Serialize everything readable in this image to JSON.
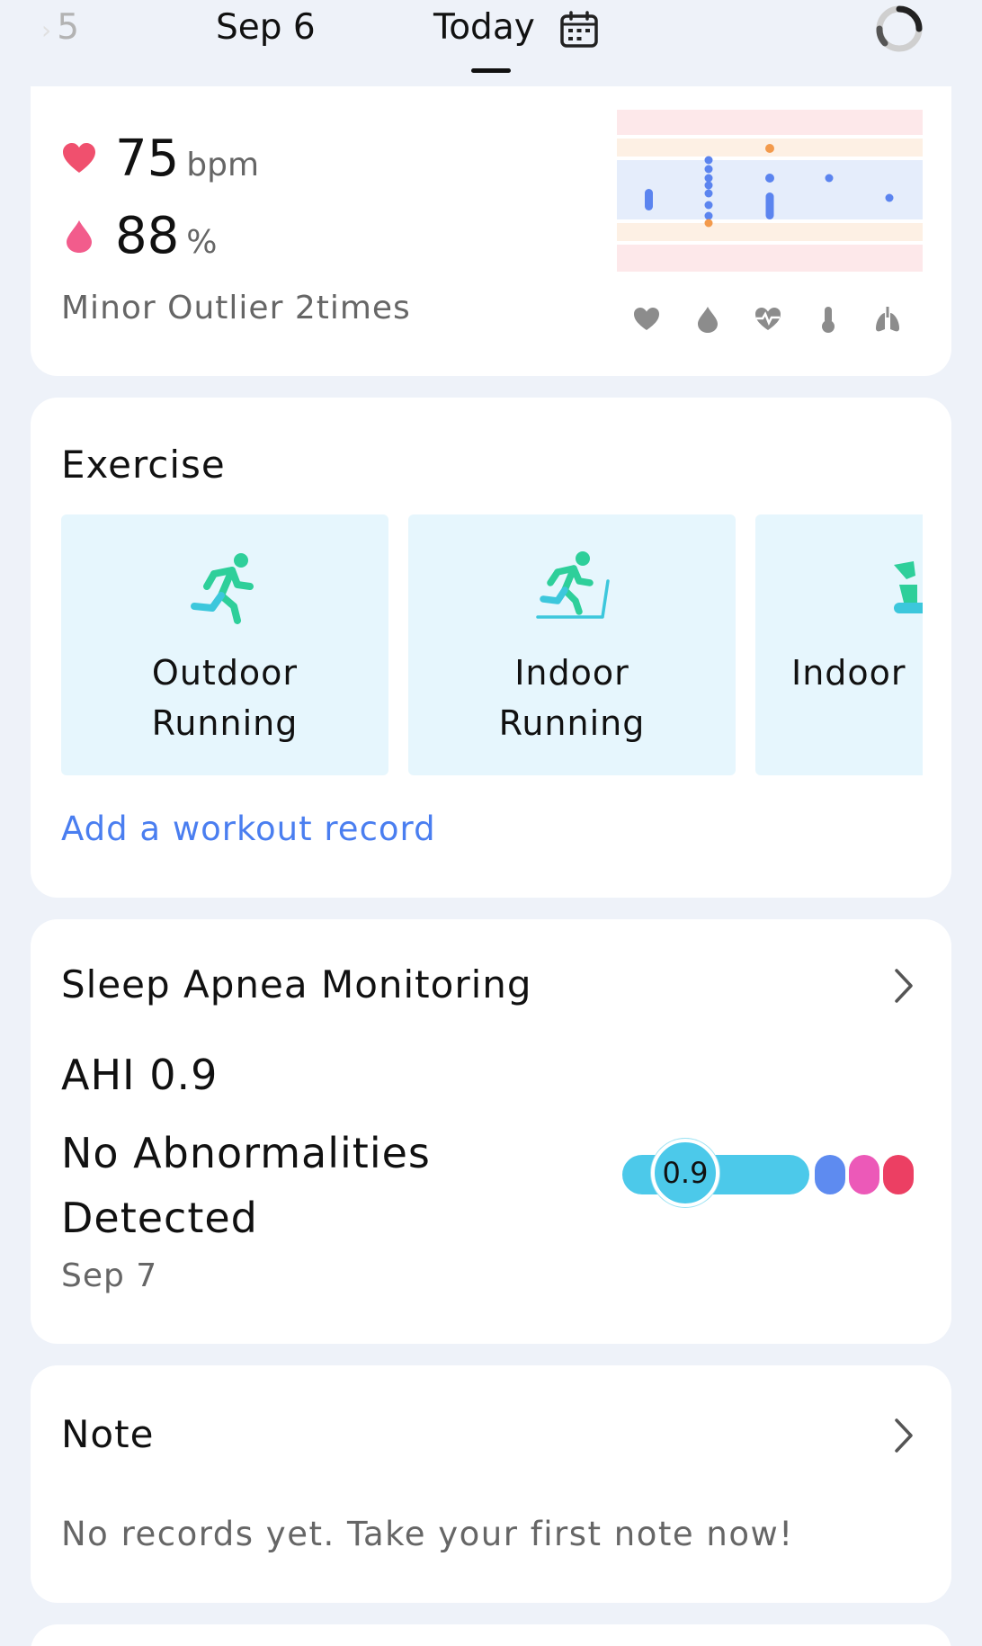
{
  "date_bar": {
    "prev_label": "5",
    "sep6_label": "Sep 6",
    "today_label": "Today",
    "calendar_icon": "calendar-icon",
    "sync_icon": "loading-ring-icon"
  },
  "vitals": {
    "heart_rate": "75",
    "heart_rate_unit": "bpm",
    "spo2": "88",
    "spo2_unit": "%",
    "outlier_text": "Minor Outlier 2times",
    "chart_icons": [
      "heart-icon",
      "drop-icon",
      "heart-pulse-icon",
      "thermometer-icon",
      "lungs-icon"
    ],
    "colors": {
      "normal_band": "#e5edfb",
      "warn_band": "#fdf0e4",
      "alert_band": "#fde8ea",
      "normal_point": "#5b84ef",
      "outlier_point": "#f39a4c"
    }
  },
  "exercise": {
    "title": "Exercise",
    "tiles": [
      {
        "line1": "Outdoor",
        "line2": "Running",
        "icon": "outdoor-running-icon"
      },
      {
        "line1": "Indoor",
        "line2": "Running",
        "icon": "indoor-running-icon"
      },
      {
        "line1": "Indoor",
        "line2": "",
        "icon": "indoor-cycling-icon"
      }
    ],
    "add_link": "Add a workout record",
    "accent": "#2ecf9a"
  },
  "apnea": {
    "title": "Sleep Apnea Monitoring",
    "ahi": "AHI 0.9",
    "status": "No Abnormalities Detected",
    "date": "Sep 7",
    "scale_value": "0.9",
    "scale_colors": [
      "#4cc9ea",
      "#5e8bf0",
      "#ec59b8",
      "#ec3f63"
    ]
  },
  "note": {
    "title": "Note",
    "empty_text": "No records yet. Take your first note now!"
  }
}
